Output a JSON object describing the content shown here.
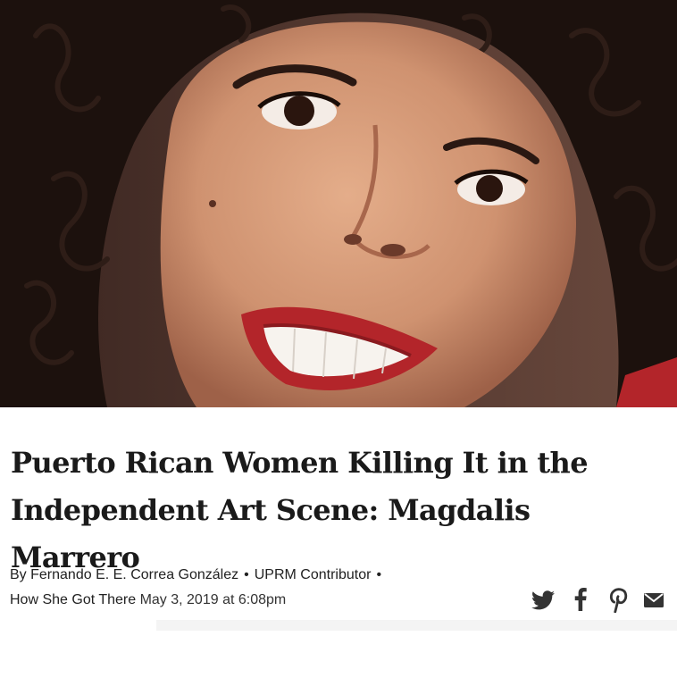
{
  "hero": {
    "image": "portrait-photo"
  },
  "article": {
    "title_line1": "Puerto Rican Women Killing It in the",
    "title_line2": "Independent Art Scene: Magdalis Marrero"
  },
  "byline": {
    "prefix": "By",
    "author": "Fernando E. E. Correa González",
    "role": "UPRM Contributor",
    "series": "How She Got There",
    "date": "May 3, 2019 at 6:08pm",
    "separator": "•"
  },
  "share": {
    "icons": [
      "twitter-icon",
      "facebook-icon",
      "pinterest-icon",
      "email-icon"
    ],
    "icon_color": "#333333"
  }
}
